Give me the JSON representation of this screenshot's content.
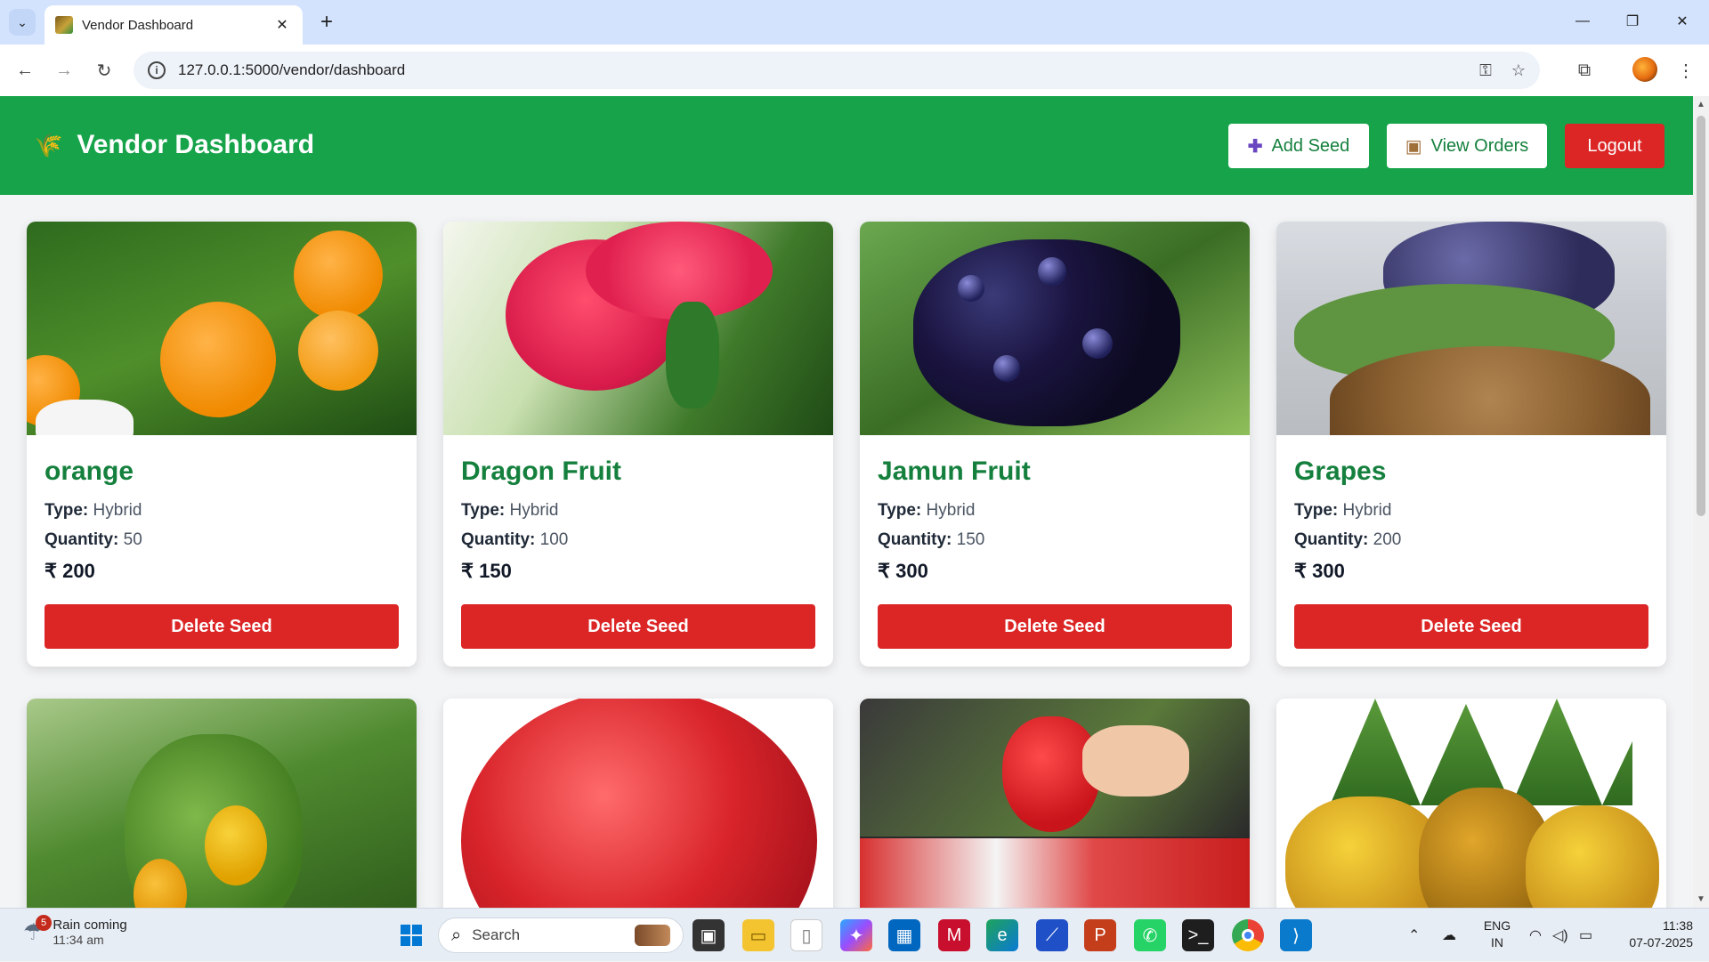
{
  "browser": {
    "tab_title": "Vendor Dashboard",
    "url": "127.0.0.1:5000/vendor/dashboard"
  },
  "header": {
    "title": "Vendor Dashboard",
    "add_seed_label": "Add Seed",
    "view_orders_label": "View Orders",
    "logout_label": "Logout"
  },
  "labels": {
    "type": "Type:",
    "quantity": "Quantity:",
    "delete": "Delete Seed",
    "currency": "₹"
  },
  "seeds": [
    {
      "name": "orange",
      "type": "Hybrid",
      "quantity": "50",
      "price": "₹ 200"
    },
    {
      "name": "Dragon Fruit",
      "type": "Hybrid",
      "quantity": "100",
      "price": "₹ 150"
    },
    {
      "name": "Jamun Fruit",
      "type": "Hybrid",
      "quantity": "150",
      "price": "₹ 300"
    },
    {
      "name": "Grapes",
      "type": "Hybrid",
      "quantity": "200",
      "price": "₹ 300"
    }
  ],
  "taskbar": {
    "weather_title": "Rain coming",
    "weather_time": "11:34 am",
    "weather_badge": "5",
    "search_placeholder": "Search",
    "lang_line1": "ENG",
    "lang_line2": "IN",
    "time": "11:38",
    "date": "07-07-2025"
  },
  "colors": {
    "header_green": "#16a34a",
    "title_green": "#15803d",
    "danger_red": "#dc2626"
  }
}
